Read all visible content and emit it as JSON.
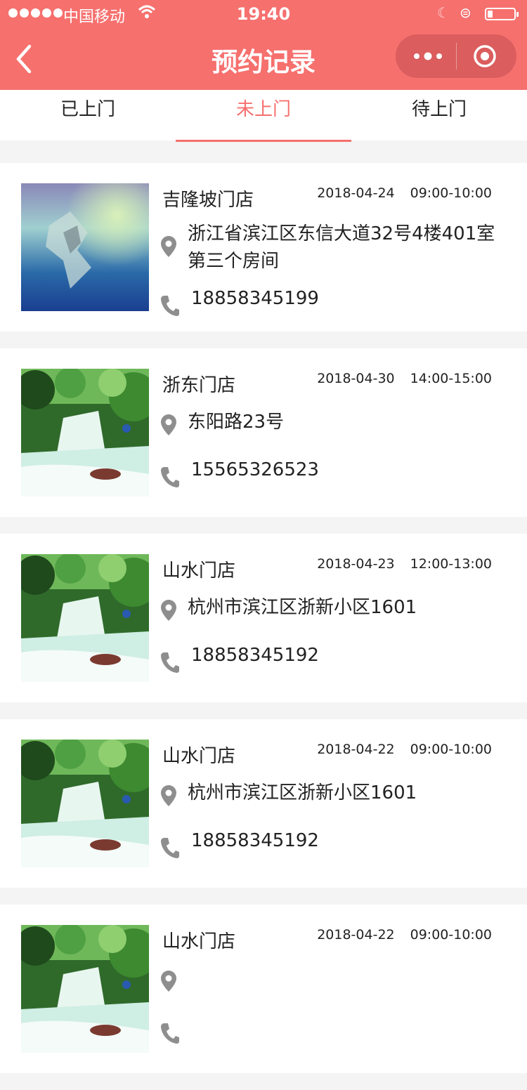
{
  "status_bar": {
    "carrier": "中国移动",
    "time": "19:40",
    "battery_percent": 18
  },
  "nav": {
    "title": "预约记录"
  },
  "tabs": [
    {
      "label": "已上门",
      "active": false
    },
    {
      "label": "未上门",
      "active": true
    },
    {
      "label": "待上门",
      "active": false
    }
  ],
  "records": [
    {
      "store": "吉隆坡门店",
      "date": "2018-04-24",
      "time": "09:00-10:00",
      "address": "浙江省滨江区东信大道32号4楼401室第三个房间",
      "phone": "18858345199",
      "image": "abstract-blue-thumbnail"
    },
    {
      "store": "浙东门店",
      "date": "2018-04-30",
      "time": "14:00-15:00",
      "address": "东阳路23号",
      "phone": "15565326523",
      "image": "waterfall-thumbnail"
    },
    {
      "store": "山水门店",
      "date": "2018-04-23",
      "time": "12:00-13:00",
      "address": "杭州市滨江区浙新小区1601",
      "phone": "18858345192",
      "image": "waterfall-thumbnail"
    },
    {
      "store": "山水门店",
      "date": "2018-04-22",
      "time": "09:00-10:00",
      "address": "杭州市滨江区浙新小区1601",
      "phone": "18858345192",
      "image": "waterfall-thumbnail"
    },
    {
      "store": "山水门店",
      "date": "2018-04-22",
      "time": "09:00-10:00",
      "address": "",
      "phone": "",
      "image": "waterfall-thumbnail"
    }
  ],
  "colors": {
    "accent": "#f6706e",
    "capsule": "#db5d5d",
    "icon_gray": "#8e8e8e"
  }
}
